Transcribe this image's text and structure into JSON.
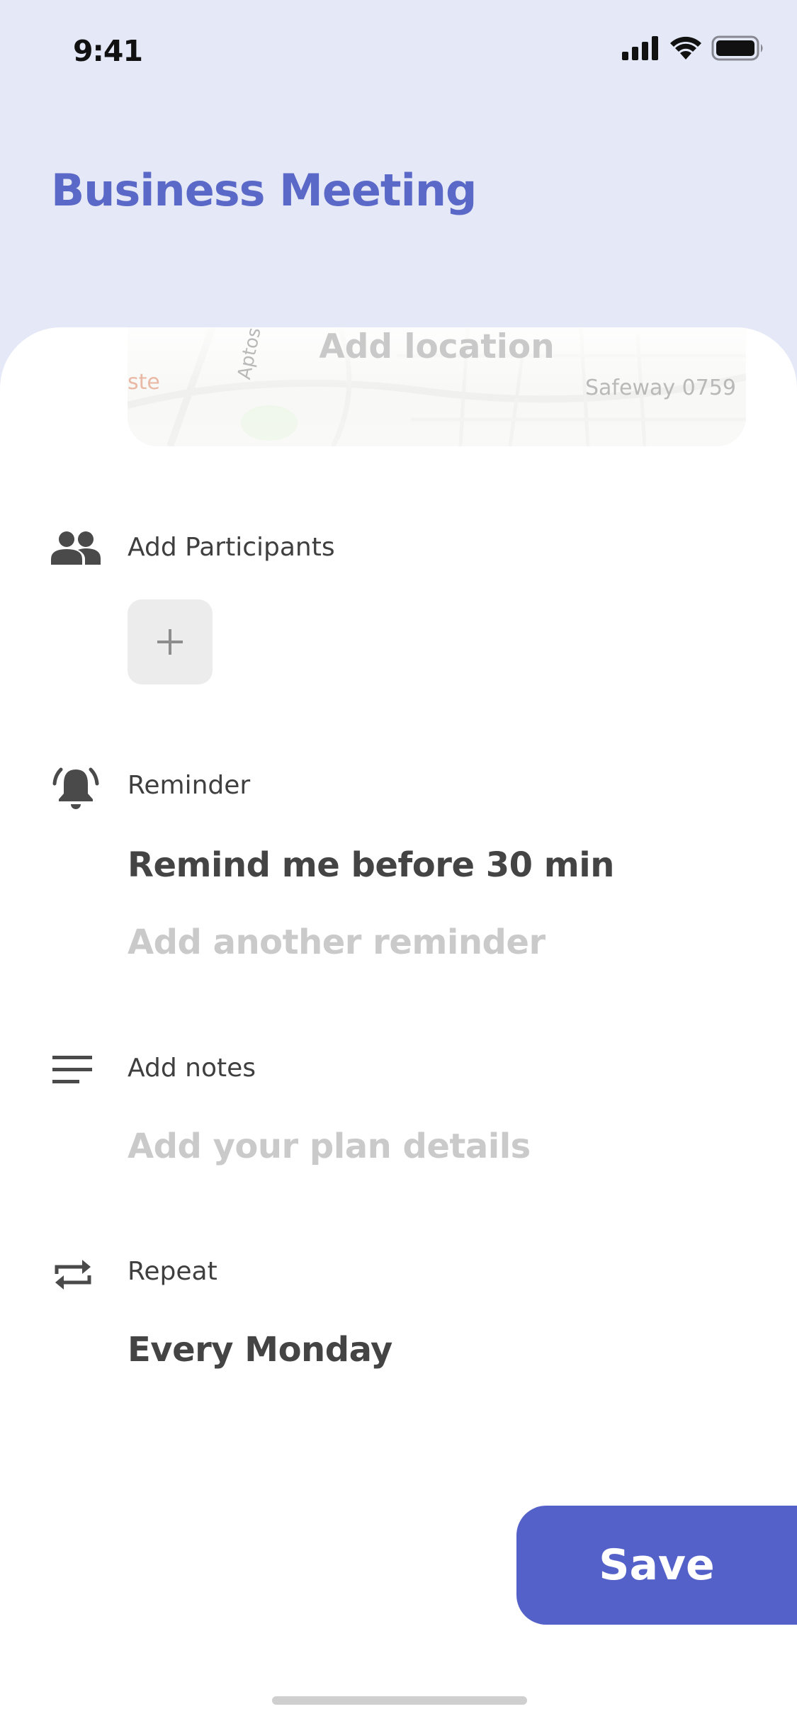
{
  "status_bar": {
    "time": "9:41",
    "icons": [
      "signal-icon",
      "wifi-icon",
      "battery-icon"
    ]
  },
  "header": {
    "title": "Business Meeting"
  },
  "location": {
    "placeholder": "Add location",
    "map_labels": {
      "street": "Aptos Ave",
      "store": "Safeway 0759",
      "edge": "ste"
    }
  },
  "participants": {
    "label": "Add Participants",
    "icon": "people-icon",
    "add_symbol": "+"
  },
  "reminder": {
    "label": "Reminder",
    "icon": "alarm-bell-icon",
    "value": "Remind me before 30 min",
    "add_another": "Add another reminder"
  },
  "notes": {
    "label": "Add notes",
    "icon": "notes-icon",
    "placeholder": "Add your plan details"
  },
  "repeat": {
    "label": "Repeat",
    "icon": "repeat-icon",
    "value": "Every Monday"
  },
  "actions": {
    "save_label": "Save"
  },
  "colors": {
    "accent": "#5461c9",
    "title": "#5a68c7",
    "header_bg": "#e5e8f7"
  }
}
